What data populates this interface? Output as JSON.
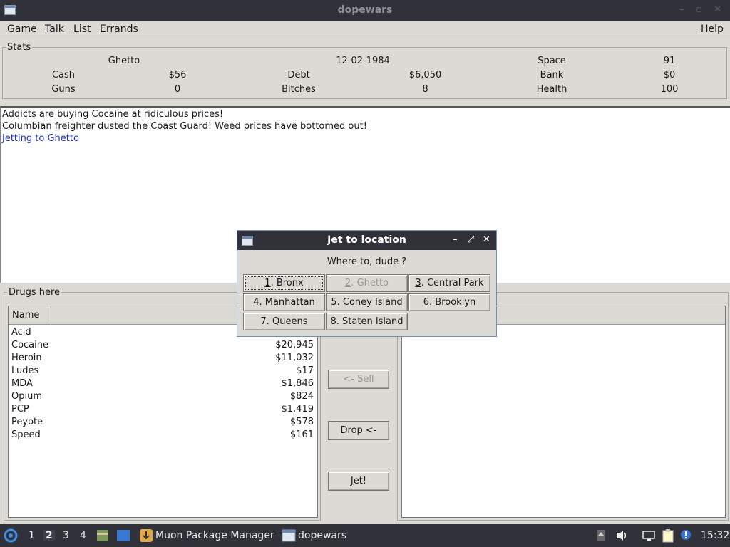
{
  "window": {
    "title": "dopewars"
  },
  "menu": [
    {
      "label": "Game",
      "accel": "G",
      "rest": "ame"
    },
    {
      "label": "Talk",
      "accel": "T",
      "rest": "alk"
    },
    {
      "label": "List",
      "accel": "L",
      "rest": "ist"
    },
    {
      "label": "Errands",
      "accel": "E",
      "rest": "rrands"
    },
    {
      "label": "Help",
      "accel": "H",
      "rest": "elp"
    }
  ],
  "stats": {
    "legend": "Stats",
    "location": "Ghetto",
    "date": "12-02-1984",
    "space_label": "Space",
    "space_value": "91",
    "cash_label": "Cash",
    "cash_value": "$56",
    "debt_label": "Debt",
    "debt_value": "$6,050",
    "bank_label": "Bank",
    "bank_value": "$0",
    "guns_label": "Guns",
    "guns_value": "0",
    "bitches_label": "Bitches",
    "bitches_value": "8",
    "health_label": "Health",
    "health_value": "100"
  },
  "messages": [
    "Addicts are buying Cocaine at ridiculous prices!",
    "Columbian freighter dusted the Coast Guard! Weed prices have bottomed out!",
    "Jetting to Ghetto"
  ],
  "drugs": {
    "legend": "Drugs here",
    "column_name": "Name",
    "rows": [
      {
        "name": "Acid",
        "price": ""
      },
      {
        "name": "Cocaine",
        "price": "$20,945"
      },
      {
        "name": "Heroin",
        "price": "$11,032"
      },
      {
        "name": "Ludes",
        "price": "$17"
      },
      {
        "name": "MDA",
        "price": "$1,846"
      },
      {
        "name": "Opium",
        "price": "$824"
      },
      {
        "name": "PCP",
        "price": "$1,419"
      },
      {
        "name": "Peyote",
        "price": "$578"
      },
      {
        "name": "Speed",
        "price": "$161"
      }
    ]
  },
  "actions": {
    "sell": "<- Sell",
    "drop_accel": "D",
    "drop_rest": "rop <-",
    "jet_accel": "J",
    "jet_rest": "et!"
  },
  "dialog": {
    "title": "Jet to location",
    "prompt": "Where to, dude ?",
    "locations": [
      {
        "num": "1",
        "name": ". Bronx"
      },
      {
        "num": "2",
        "name": ". Ghetto"
      },
      {
        "num": "3",
        "name": ". Central Park"
      },
      {
        "num": "4",
        "name": ". Manhattan"
      },
      {
        "num": "5",
        "name": ". Coney Island"
      },
      {
        "num": "6",
        "name": ". Brooklyn"
      },
      {
        "num": "7",
        "name": ". Queens"
      },
      {
        "num": "8",
        "name": ". Staten Island"
      }
    ]
  },
  "taskbar": {
    "desktops": [
      "1",
      "2",
      "3",
      "4"
    ],
    "apps": [
      "Muon Package Manager",
      "dopewars"
    ],
    "clock": "15:32"
  }
}
